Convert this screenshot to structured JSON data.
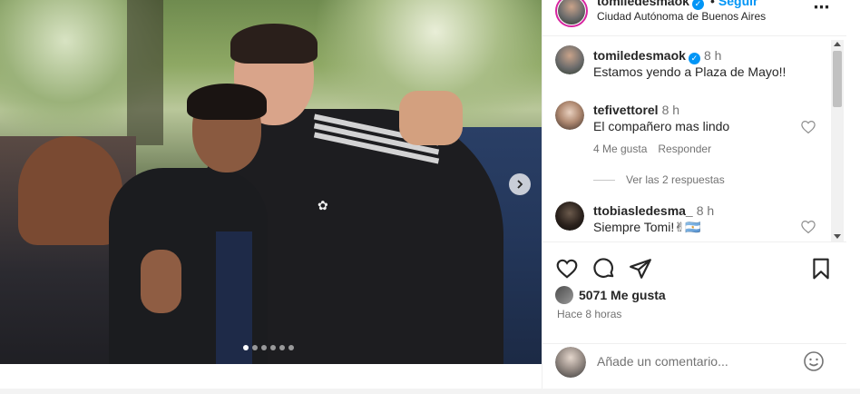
{
  "post": {
    "username": "tomiledesmaok",
    "follow_label": "Seguir",
    "follow_separator": "•",
    "location": "Ciudad Autónoma de Buenos Aires",
    "caption_text": "Estamos yendo a Plaza de Mayo!!",
    "caption_time": "8 h",
    "likes_text": "5071 Me gusta",
    "posted_ago": "Hace 8 horas",
    "more_icon": "⋯"
  },
  "comments": [
    {
      "username": "tefivettorel",
      "time": "8 h",
      "text": "El compañero mas lindo",
      "likes": "4 Me gusta",
      "reply_label": "Responder",
      "view_replies": "Ver las 2 respuestas"
    },
    {
      "username": "ttobiasledesma_",
      "time": "8 h",
      "text": "Siempre Tomi!✌🇦🇷"
    }
  ],
  "add_comment": {
    "placeholder": "Añade un comentario..."
  },
  "photo": {
    "carousel_dots": 6,
    "active_dot": 0,
    "shirt_logo": "✿"
  },
  "icons": {
    "verified": "verified-badge-icon",
    "heart": "heart-icon",
    "comment": "comment-icon",
    "share": "share-icon",
    "save": "bookmark-icon",
    "emoji": "emoji-icon",
    "next": "chevron-right-icon"
  },
  "colors": {
    "accent": "#0095f6",
    "text": "#262626",
    "muted": "#737373",
    "story_ring": "#d6249f"
  }
}
